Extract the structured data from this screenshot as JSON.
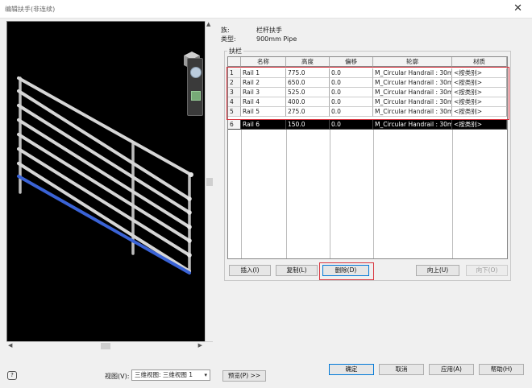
{
  "window": {
    "title": "编辑扶手(非连续)",
    "close_glyph": "✕"
  },
  "viewport": {
    "scroll_up": "▲",
    "scroll_down": "▼",
    "scroll_left": "◀",
    "scroll_right": "▶"
  },
  "info": {
    "family_label": "族:",
    "family_value": "栏杆扶手",
    "type_label": "类型:",
    "type_value": "900mm Pipe",
    "group_label": "扶栏"
  },
  "table": {
    "headers": [
      "",
      "名称",
      "高度",
      "偏移",
      "轮廓",
      "材质"
    ],
    "rows": [
      {
        "num": "1",
        "name": "Rail 1",
        "height": "775.0",
        "offset": "0.0",
        "profile": "M_Circular Handrail : 30m",
        "material": "<按类别>"
      },
      {
        "num": "2",
        "name": "Rail 2",
        "height": "650.0",
        "offset": "0.0",
        "profile": "M_Circular Handrail : 30m",
        "material": "<按类别>"
      },
      {
        "num": "3",
        "name": "Rail 3",
        "height": "525.0",
        "offset": "0.0",
        "profile": "M_Circular Handrail : 30m",
        "material": "<按类别>"
      },
      {
        "num": "4",
        "name": "Rail 4",
        "height": "400.0",
        "offset": "0.0",
        "profile": "M_Circular Handrail : 30m",
        "material": "<按类别>"
      },
      {
        "num": "5",
        "name": "Rail 5",
        "height": "275.0",
        "offset": "0.0",
        "profile": "M_Circular Handrail : 30m",
        "material": "<按类别>"
      },
      {
        "num": "6",
        "name": "Rail 6",
        "height": "150.0",
        "offset": "0.0",
        "profile": "M_Circular Handrail : 30m",
        "material": "<按类别>"
      }
    ]
  },
  "buttons": {
    "insert": "插入(I)",
    "copy": "复制(L)",
    "delete": "删除(D)",
    "up": "向上(U)",
    "down": "向下(O)",
    "ok": "确定",
    "cancel": "取消",
    "apply": "应用(A)",
    "help": "帮助(H)",
    "preview": "预览(P) >>"
  },
  "bottom": {
    "view_label": "视图(V):",
    "view_value": "三维视图: 三维视图 1",
    "dropdown_glyph": "▾"
  },
  "colors": {
    "highlight": "#d8323c",
    "selected_rail": "#3a63d6",
    "selection_bg": "#000000"
  }
}
